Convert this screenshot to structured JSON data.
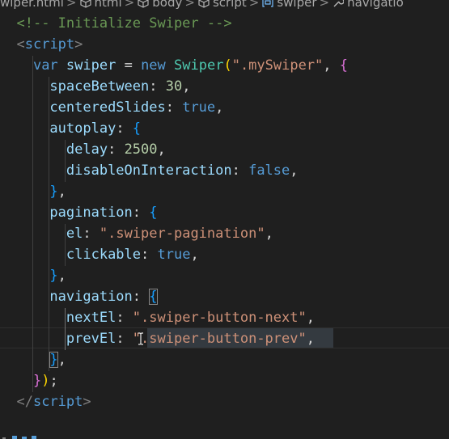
{
  "breadcrumb": {
    "items": [
      {
        "label": "wiper.html",
        "icon": "none"
      },
      {
        "label": "html",
        "icon": "cube-icon"
      },
      {
        "label": "body",
        "icon": "cube-icon"
      },
      {
        "label": "script",
        "icon": "cube-icon"
      },
      {
        "label": "swiper",
        "icon": "variable-icon"
      },
      {
        "label": "navigatio",
        "icon": "wrench-icon"
      }
    ],
    "separator": ">"
  },
  "code": {
    "l1": {
      "indent": "  ",
      "text": "<!-- Initialize Swiper -->"
    },
    "l2": {
      "indent": "  ",
      "open": "<",
      "name": "script",
      "close": ">"
    },
    "l3": {
      "indent": "    ",
      "kw": "var",
      "var": "swiper",
      "eq": " = ",
      "newkw": "new",
      "cls": "Swiper",
      "p1": "(",
      "arg": "\".mySwiper\"",
      "comma": ", ",
      "brace": "{"
    },
    "l4": {
      "indent": "      ",
      "key": "spaceBetween",
      "colon": ": ",
      "val": "30",
      "end": ","
    },
    "l5": {
      "indent": "      ",
      "key": "centeredSlides",
      "colon": ": ",
      "val": "true",
      "end": ","
    },
    "l6": {
      "indent": "      ",
      "key": "autoplay",
      "colon": ": ",
      "brace": "{"
    },
    "l7": {
      "indent": "        ",
      "key": "delay",
      "colon": ": ",
      "val": "2500",
      "end": ","
    },
    "l8": {
      "indent": "        ",
      "key": "disableOnInteraction",
      "colon": ": ",
      "val": "false",
      "end": ","
    },
    "l9": {
      "indent": "      ",
      "brace": "}",
      "end": ","
    },
    "l10": {
      "indent": "      ",
      "key": "pagination",
      "colon": ": ",
      "brace": "{"
    },
    "l11": {
      "indent": "        ",
      "key": "el",
      "colon": ": ",
      "val": "\".swiper-pagination\"",
      "end": ","
    },
    "l12": {
      "indent": "        ",
      "key": "clickable",
      "colon": ": ",
      "val": "true",
      "end": ","
    },
    "l13": {
      "indent": "      ",
      "brace": "}",
      "end": ","
    },
    "l14": {
      "indent": "      ",
      "key": "navigation",
      "colon": ": ",
      "brace": "{"
    },
    "l15": {
      "indent": "        ",
      "key": "nextEl",
      "colon": ": ",
      "val": "\".swiper-button-next\"",
      "end": ","
    },
    "l16": {
      "indent": "        ",
      "key": "prevEl",
      "colon": ": ",
      "val": "\".swiper-button-prev\"",
      "end": ","
    },
    "l17": {
      "indent": "      ",
      "brace": "}",
      "end": ","
    },
    "l18": {
      "indent": "    ",
      "brace": "}",
      "paren": ")",
      "end": ";"
    },
    "l19": {
      "indent": "  ",
      "open": "</",
      "name": "script",
      "close": ">"
    }
  },
  "colors": {
    "background": "#1f1f1f",
    "comment": "#6a9955",
    "keyword": "#569cd6",
    "variable": "#9cdcfe",
    "class": "#4ec9b0",
    "string": "#ce9178",
    "number": "#b5cea8",
    "bracket_level1": "#ffd700",
    "bracket_level2": "#da70d6",
    "bracket_level3": "#179fff"
  }
}
